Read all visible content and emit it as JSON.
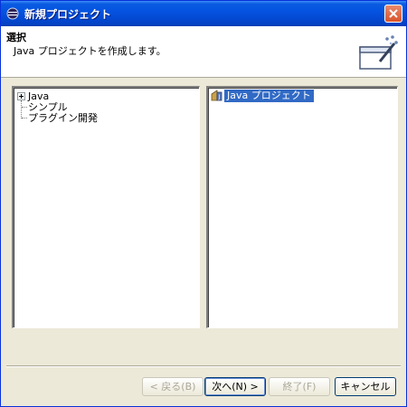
{
  "window": {
    "title": "新規プロジェクト"
  },
  "banner": {
    "title": "選択",
    "description": "Java プロジェクトを作成します。"
  },
  "left_tree": {
    "items": [
      {
        "label": "Java",
        "expandable": true,
        "selected": false
      },
      {
        "label": "シンプル"
      },
      {
        "label": "プラグイン開発"
      }
    ]
  },
  "right_list": {
    "items": [
      {
        "label": "Java プロジェクト",
        "icon": "java-project-icon",
        "selected": true
      }
    ]
  },
  "buttons": {
    "back": "< 戻る(B)",
    "next": "次へ(N) >",
    "finish": "終了(F)",
    "cancel": "キャンセル"
  },
  "colors": {
    "selection": "#316ac5",
    "titlebar": "#0553e1",
    "dialog_bg": "#ece9d8"
  }
}
